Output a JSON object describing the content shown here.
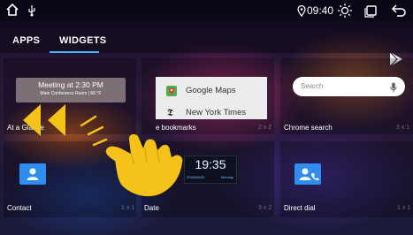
{
  "status_bar": {
    "home_icon": "home-icon",
    "usb_icon": "usb-icon",
    "location_icon": "location-pin-icon",
    "time": "09:40",
    "brightness_icon": "brightness-icon",
    "recents_icon": "recents-icon",
    "back_icon": "back-icon"
  },
  "tabs": {
    "apps": "APPS",
    "widgets": "WIDGETS",
    "active": "WIDGETS"
  },
  "widgets": [
    {
      "label": "At a Glance",
      "size": ""
    },
    {
      "label": "e bookmarks",
      "size": "2 x 2"
    },
    {
      "label": "Chrome search",
      "size": "3 x 1"
    },
    {
      "label": "Contact",
      "size": "1 x 1"
    },
    {
      "label": "Date",
      "size": "3 x 2"
    },
    {
      "label": "Direct dial",
      "size": "1 x 1"
    }
  ],
  "glance_preview": {
    "title": "Meeting at 2:30 PM",
    "subtitle": "Main Conference Room | 66 °F"
  },
  "bookmarks_preview": {
    "items": [
      {
        "label": "Google Maps",
        "icon": "google-maps-icon"
      },
      {
        "label": "New York Times",
        "icon": "nytimes-icon"
      }
    ]
  },
  "search_preview": {
    "placeholder": "Search",
    "mic_icon": "mic-icon"
  },
  "clock_preview": {
    "time": "19:35",
    "date": "2016/08/03",
    "day": "Monday"
  },
  "overlay": {
    "gesture_icon": "swipe-hand-icon",
    "arrows_icon": "double-left-arrow-icon",
    "accent_color": "#f5c21a"
  }
}
